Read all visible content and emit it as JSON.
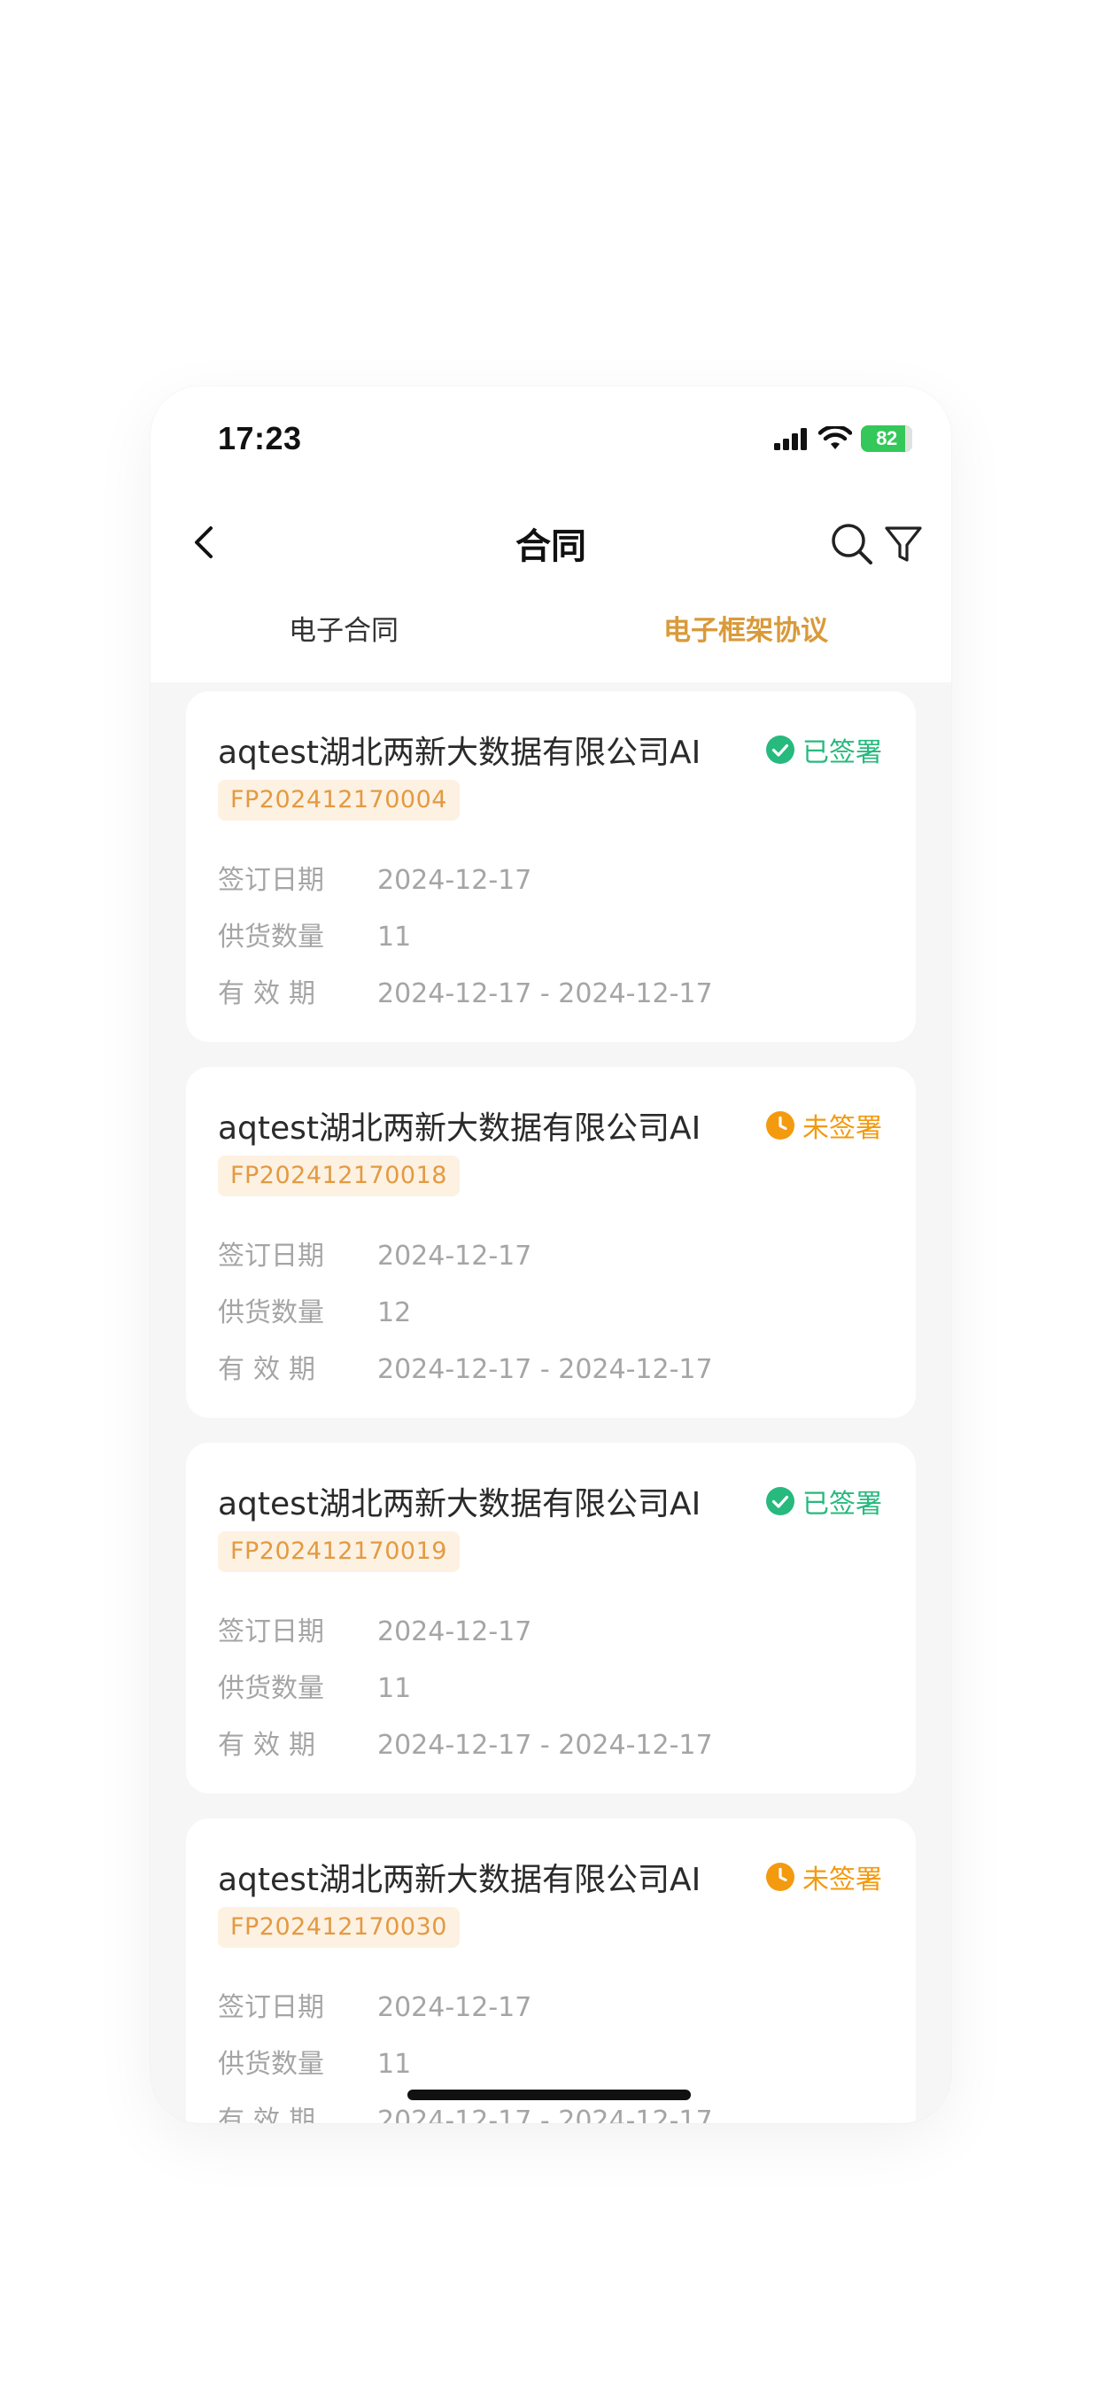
{
  "status_bar": {
    "time": "17:23",
    "battery": "82"
  },
  "nav": {
    "title": "合同",
    "back_icon": "chevron-left-icon",
    "search_icon": "search-icon",
    "filter_icon": "filter-icon"
  },
  "tabs": [
    {
      "label": "电子合同",
      "active": false
    },
    {
      "label": "电子框架协议",
      "active": true
    }
  ],
  "labels": {
    "sign_date": "签订日期",
    "supply_qty": "供货数量",
    "validity": "有效期"
  },
  "contracts": [
    {
      "company": "aqtest湖北两新大数据有限公司AI",
      "code": "FP202412170004",
      "status": "已签署",
      "sign_date": "2024-12-17",
      "supply_qty": "11",
      "validity": "2024-12-17 - 2024-12-17"
    },
    {
      "company": "aqtest湖北两新大数据有限公司AI",
      "code": "FP202412170018",
      "status": "未签署",
      "sign_date": "2024-12-17",
      "supply_qty": "12",
      "validity": "2024-12-17 - 2024-12-17"
    },
    {
      "company": "aqtest湖北两新大数据有限公司AI",
      "code": "FP202412170019",
      "status": "已签署",
      "sign_date": "2024-12-17",
      "supply_qty": "11",
      "validity": "2024-12-17 - 2024-12-17"
    },
    {
      "company": "aqtest湖北两新大数据有限公司AI",
      "code": "FP202412170030",
      "status": "未签署",
      "sign_date": "2024-12-17",
      "supply_qty": "11",
      "validity": "2024-12-17 - 2024-12-17"
    }
  ],
  "colors": {
    "accent": "#d99a3a",
    "signed": "#27b97e",
    "unsigned": "#f39a0f",
    "code_bg": "#fdf1e2",
    "code_text": "#e39a42"
  }
}
